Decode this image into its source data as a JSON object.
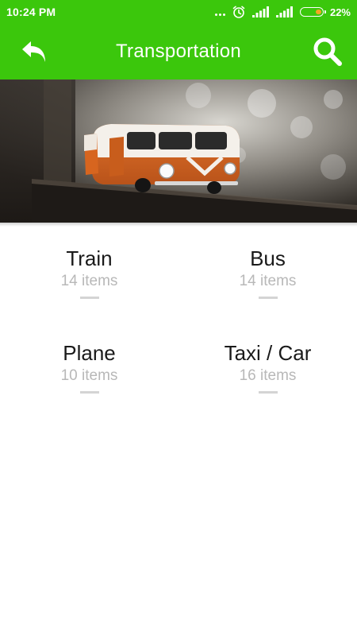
{
  "status_bar": {
    "time": "10:24 PM",
    "battery_percent": "22%",
    "battery_level": 0.22,
    "icons": [
      "more-dots-icon",
      "alarm-icon",
      "signal-icon",
      "signal-icon",
      "battery-icon"
    ]
  },
  "app_bar": {
    "title": "Transportation",
    "back_icon": "reply-arrow-icon",
    "search_icon": "search-icon",
    "background_color": "#3bc70c"
  },
  "hero": {
    "subject": "orange-and-white-toy-van-photo"
  },
  "categories": [
    {
      "name": "Train",
      "count": "14 items"
    },
    {
      "name": "Bus",
      "count": "14 items"
    },
    {
      "name": "Plane",
      "count": "10 items"
    },
    {
      "name": "Taxi / Car",
      "count": "16 items"
    }
  ],
  "colors": {
    "accent": "#3bc70c",
    "title_text": "#1a1a1a",
    "count_text": "#b8b8b8",
    "divider": "#d4d4d4",
    "battery_fill": "#f5a623"
  }
}
